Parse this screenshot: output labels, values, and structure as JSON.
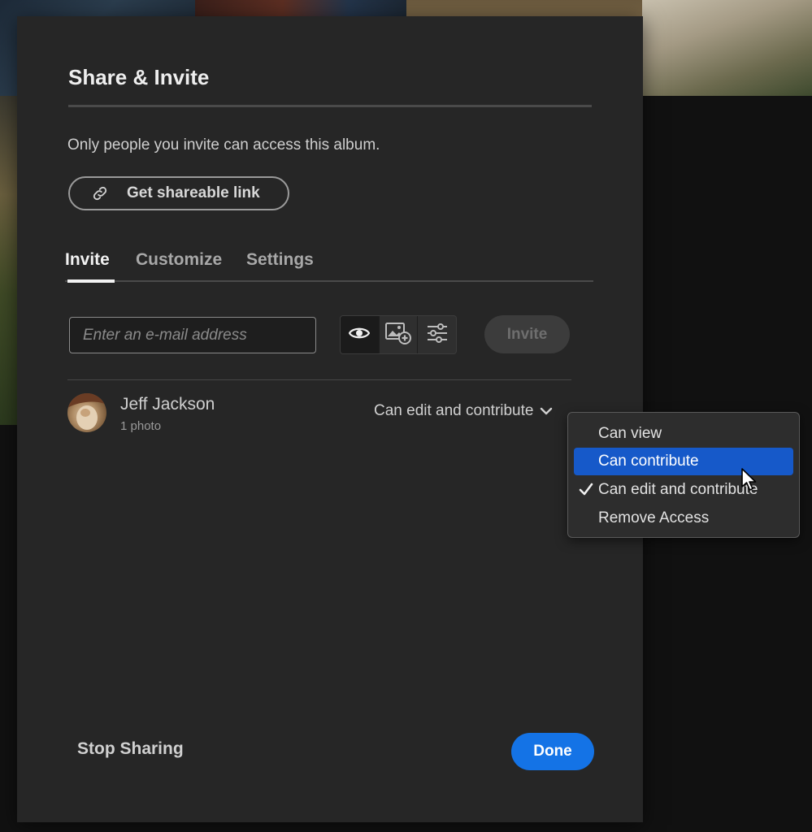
{
  "dialog": {
    "title": "Share & Invite",
    "description": "Only people you invite can access this album.",
    "shareable_link_label": "Get shareable link"
  },
  "tabs": [
    {
      "label": "Invite",
      "active": true
    },
    {
      "label": "Customize",
      "active": false
    },
    {
      "label": "Settings",
      "active": false
    }
  ],
  "invite": {
    "email_placeholder": "Enter an e-mail address",
    "permission_icons": [
      "eye-icon",
      "add-photo-icon",
      "sliders-icon"
    ],
    "selected_permission": "eye-icon",
    "button_label": "Invite",
    "button_enabled": false
  },
  "member": {
    "name": "Jeff Jackson",
    "subtitle": "1 photo",
    "role": "Can edit and contribute"
  },
  "role_menu": {
    "items": [
      {
        "label": "Can view",
        "checked": false,
        "hovered": false
      },
      {
        "label": "Can contribute",
        "checked": false,
        "hovered": true
      },
      {
        "label": "Can edit and contribute",
        "checked": true,
        "hovered": false
      },
      {
        "label": "Remove Access",
        "checked": false,
        "hovered": false
      }
    ]
  },
  "footer": {
    "stop_sharing_label": "Stop Sharing",
    "done_label": "Done"
  },
  "colors": {
    "accent": "#1473e6",
    "menu_hover": "#1659c9",
    "dialog_bg": "#262626"
  }
}
